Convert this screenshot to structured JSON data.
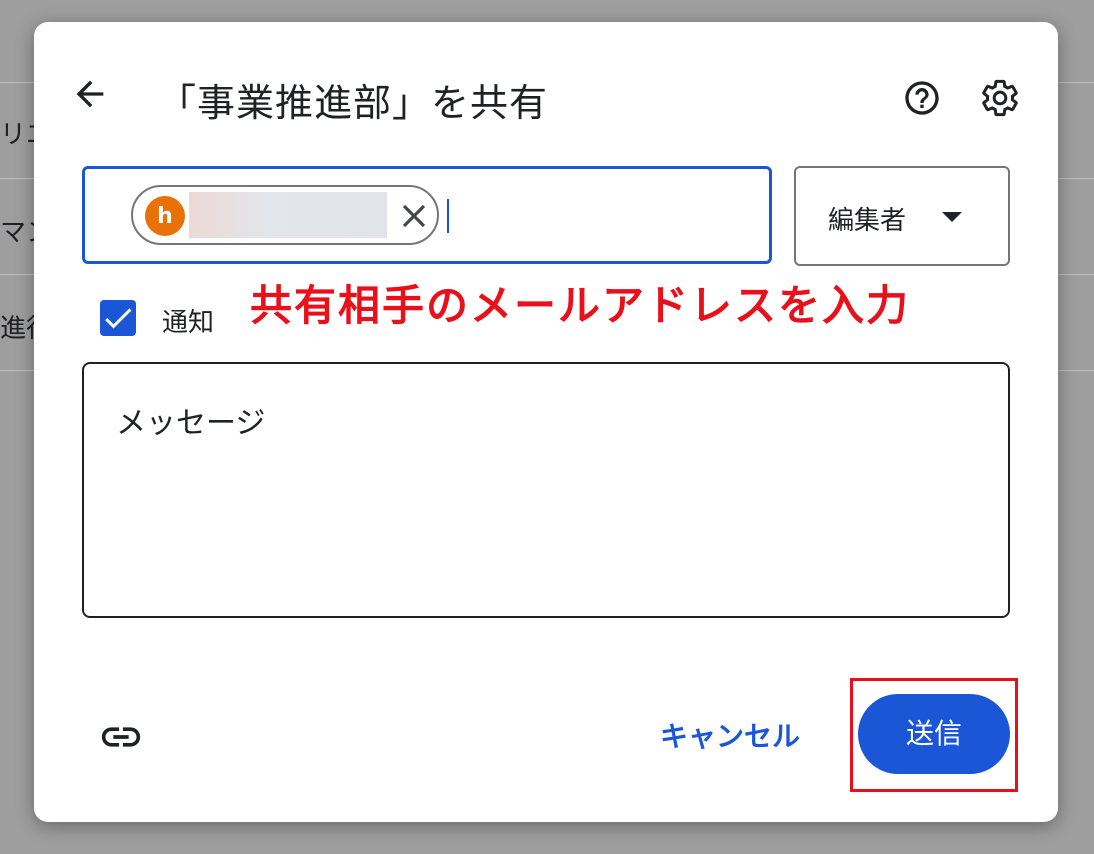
{
  "dialog": {
    "title": "「事業推進部」を共有",
    "back_icon": "arrow-back-icon",
    "help_icon": "help-circle-icon",
    "settings_icon": "gear-icon"
  },
  "recipients": {
    "chips": [
      {
        "avatar_letter": "h",
        "avatar_color": "#e8710a",
        "remove_icon": "close-icon"
      }
    ]
  },
  "role": {
    "selected": "編集者",
    "arrow_icon": "dropdown-arrow-icon"
  },
  "annotation": {
    "text": "共有相手のメールアドレスを入力",
    "color": "#e8101a"
  },
  "notify": {
    "label": "通知",
    "checked": true
  },
  "message": {
    "placeholder": "メッセージ"
  },
  "footer": {
    "link_icon": "link-icon",
    "cancel_label": "キャンセル",
    "send_label": "送信"
  },
  "background_list": {
    "fragments": [
      "リエ",
      "マン",
      "進行"
    ]
  },
  "colors": {
    "accent": "#1a56d6",
    "highlight": "#e8101a"
  }
}
